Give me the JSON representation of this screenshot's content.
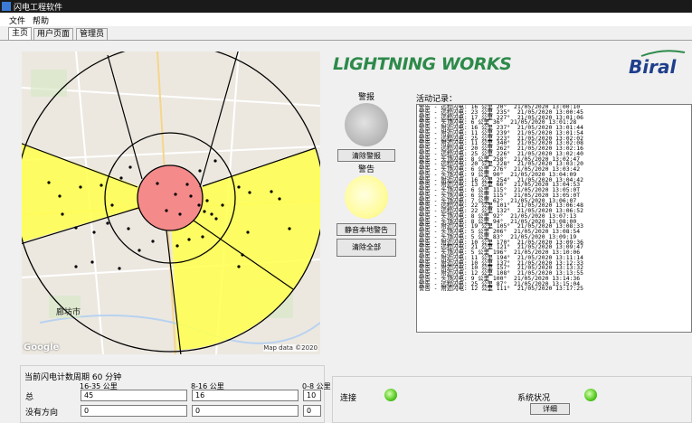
{
  "window": {
    "title": "闪电工程软件"
  },
  "menu": {
    "file": "文件",
    "help": "帮助"
  },
  "tabs": [
    "主页",
    "用户页面",
    "管理员"
  ],
  "map": {
    "watermark": "Google",
    "copyright": "Map data ©2020",
    "city_label": "廊坊市"
  },
  "brand": {
    "product": "LIGHTNING WORKS",
    "company": "Biral"
  },
  "alarm": {
    "label": "警报",
    "clear_button": "清除警报",
    "lamp_color": "#b4b4b4"
  },
  "warning": {
    "label": "警告",
    "mute_button": "静音本地警告",
    "clear_all_button": "清除全部",
    "lamp_color": "#fffb9a"
  },
  "log": {
    "title": "活动记录：",
    "entries": [
      "警告 - 远程闪电: 16 公里 20°  21/05/2020 13:00:10",
      "警告 - 远程闪电: 23 公里 235°  21/05/2020 13:00:45",
      "警告 - 远程闪电: 17 公里 227°  21/05/2020 13:01:06",
      "警告 - 头顶闪电: 6 公里 36°  21/05/2020 13:01:28",
      "警告 - 附近闪电: 16 公里 237°  21/05/2020 13:01:44",
      "警告 - 附近闪电: 11 公里 239°  21/05/2020 13:01:54",
      "警告 - 远程闪电: 25 公里 223°  21/05/2020 13:02:02",
      "警告 - 附近闪电: 11 公里 340°  21/05/2020 13:02:08",
      "警告 - 远程闪电: 20 公里 262°  21/05/2020 13:02:16",
      "警告 - 远程闪电: 25 公里 226°  21/05/2020 13:02:40",
      "警告 - 头顶闪电: 8 公里 258°  21/05/2020 13:02:47",
      "警告 - 远程闪电: 20 公里 228°  21/05/2020 13:03:20",
      "警告 - 头顶闪电: 6 公里 276°  21/05/2020 13:03:42",
      "警告 - 头顶闪电: 9 公里 90°  21/05/2020 13:04:09",
      "警告 - 附近闪电: 16 公里 254°  21/05/2020 13:04:42",
      "警告 - 附近闪电: 13 公里 66°  21/05/2020 13:04:53",
      "警告 - 头顶闪电: 6 公里 115°  21/05/2020 13:05:0T",
      "警告 - 头顶闪电: 6 公里 115°  21/05/2020 13:05:0T",
      "警告 - 头顶闪电: 7 公里 62°  21/05/2020 13:06:07",
      "警告 - 远程闪电: 22 公里 101°  21/05/2020 13:06:48",
      "警告 - 远程闪电: 22 公里 132°  21/05/2020 13:06:52",
      "警告 - 头顶闪电: 8 公里 92°  21/05/2020 13:07:13",
      "警告 - 头顶闪电: 8 公里 94°  21/05/2020 13:08:00",
      "警告 - 附近闪电: 19 公里 105°  21/05/2020 13:08:33",
      "警告 - 头顶闪电: 5 公里 206°  21/05/2020 13:08:54",
      "警告 - 头顶闪电: 5 公里 83°  21/05/2020 13:09:19",
      "警告 - 附近闪电: 10 公里 170°  21/05/2020 13:09:36",
      "警告 - 远程闪电: 21 公里 121°  21/05/2020 13:09:47",
      "警告 - 头顶闪电: 5 公里 196°  21/05/2020 13:10:06",
      "警告 - 附近闪电: 11 公里 194°  21/05/2020 13:11:14",
      "警告 - 附近闪电: 10 公里 137°  21/05/2020 13:12:33",
      "警告 - 附近闪电: 10 公里 157°  21/05/2020 13:13:32",
      "警告 - 附近闪电: 12 公里 108°  21/05/2020 13:13:55",
      "警告 - 头顶闪电: 9 公里 100°  21/05/2020 13:14:36",
      "警告 - 远程闪电: 25 公里 87°  21/05/2020 13:15:04",
      "警告 - 附近闪电: 12 公里 111°  21/05/2020 13:17:25"
    ]
  },
  "counts": {
    "title": "当前闪电计数周期 60 分钟",
    "col_far": "16-35 公里",
    "col_near": "8-16 公里",
    "col_overhead": "0-8 公里",
    "row_total": "总",
    "row_no_direction": "没有方向",
    "total": {
      "far": "45",
      "near": "16",
      "overhead": "10"
    },
    "no_direction": {
      "far": "0",
      "near": "0",
      "overhead": "0"
    }
  },
  "status": {
    "connection_label": "连接",
    "system_label": "系统状况",
    "details_button": "详细",
    "led_color": "#52c81e"
  }
}
